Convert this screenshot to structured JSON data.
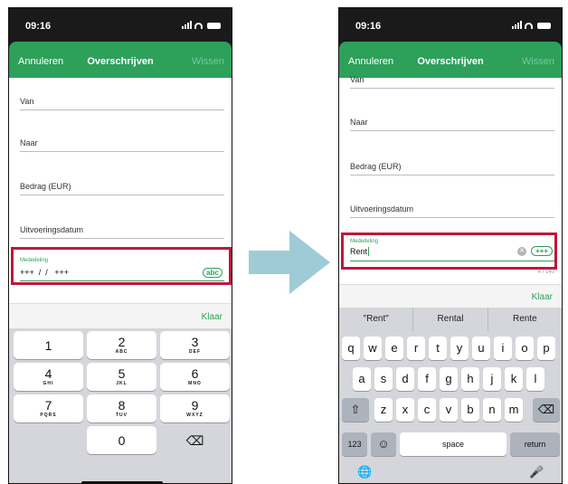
{
  "status": {
    "time": "09:16"
  },
  "nav": {
    "cancel": "Annuleren",
    "title": "Overschrijven",
    "clear": "Wissen"
  },
  "form": {
    "from_label": "Van",
    "to_label": "Naar",
    "amount_label": "Bedrag (EUR)",
    "date_label": "Uitvoeringsdatum",
    "memo_label": "Mededeling"
  },
  "left": {
    "memo_value": "+++  /  /   +++",
    "abc_toggle": "abc",
    "done": "Klaar",
    "numpad": [
      {
        "n": "1",
        "l": ""
      },
      {
        "n": "2",
        "l": "ABC"
      },
      {
        "n": "3",
        "l": "DEF"
      },
      {
        "n": "4",
        "l": "GHI"
      },
      {
        "n": "5",
        "l": "JKL"
      },
      {
        "n": "6",
        "l": "MNO"
      },
      {
        "n": "7",
        "l": "PQRS"
      },
      {
        "n": "8",
        "l": "TUV"
      },
      {
        "n": "9",
        "l": "WXYZ"
      },
      {
        "n": "0",
        "l": ""
      }
    ],
    "backspace": "⌫"
  },
  "right": {
    "memo_value": "Rent",
    "structured_toggle": "+++",
    "counter": "4 / 140",
    "done": "Klaar",
    "suggestions": [
      "\"Rent\"",
      "Rental",
      "Rente"
    ],
    "row1": [
      "q",
      "w",
      "e",
      "r",
      "t",
      "y",
      "u",
      "i",
      "o",
      "p"
    ],
    "row2": [
      "a",
      "s",
      "d",
      "f",
      "g",
      "h",
      "j",
      "k",
      "l"
    ],
    "row3": [
      "z",
      "x",
      "c",
      "v",
      "b",
      "n",
      "m"
    ],
    "shift": "⇧",
    "backspace": "⌫",
    "num_key": "123",
    "emoji": "☺",
    "space": "space",
    "return": "return",
    "globe": "🌐",
    "mic": "🎤"
  },
  "colors": {
    "accent": "#2da05a",
    "highlight": "#c0183a",
    "arrow": "#9fcbd6"
  }
}
